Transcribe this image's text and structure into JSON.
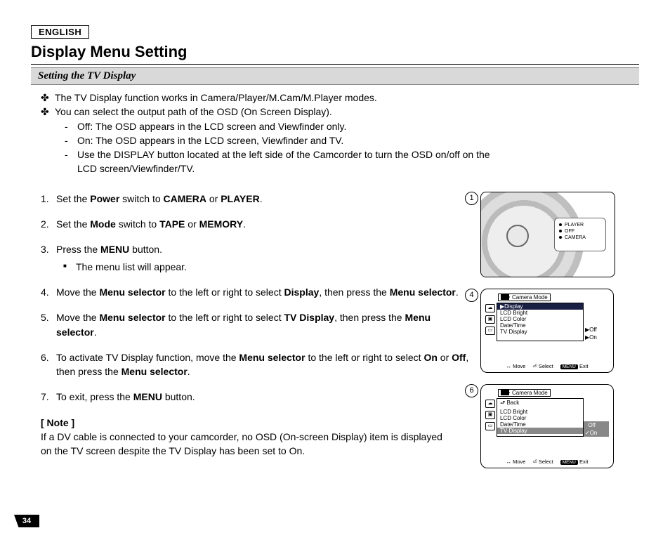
{
  "header": {
    "language": "ENGLISH",
    "title": "Display Menu Setting",
    "subhead": "Setting the TV Display"
  },
  "intro": {
    "line1": "The TV Display function works in Camera/Player/M.Cam/M.Player modes.",
    "line2": "You can select the output path of the OSD (On Screen Display).",
    "sub1": "Off: The OSD appears in the LCD screen and Viewfinder only.",
    "sub2": "On: The OSD appears in the LCD screen, Viewfinder and TV.",
    "sub3a": "Use the DISPLAY button located at the left side of the Camcorder to turn the OSD on/off on the",
    "sub3b": "LCD screen/Viewfinder/TV."
  },
  "steps": {
    "s1a": "Set the ",
    "s1b": "Power",
    "s1c": " switch to ",
    "s1d": "CAMERA",
    "s1e": " or ",
    "s1f": "PLAYER",
    "s1g": ".",
    "s2a": "Set the ",
    "s2b": "Mode",
    "s2c": " switch to ",
    "s2d": "TAPE",
    "s2e": " or ",
    "s2f": "MEMORY",
    "s2g": ".",
    "s3a": "Press the ",
    "s3b": "MENU",
    "s3c": " button.",
    "s3sub": "The menu list will appear.",
    "s4a": "Move the ",
    "s4b": "Menu selector",
    "s4c": " to the left or right to select ",
    "s4d": "Display",
    "s4e": ", then press the ",
    "s4f": "Menu selector",
    "s4g": ".",
    "s5a": "Move the ",
    "s5b": "Menu selector",
    "s5c": " to the left or right to select ",
    "s5d": "TV Display",
    "s5e": ", then press the ",
    "s5f": "Menu selector",
    "s5g": ".",
    "s6a": "To activate TV Display function, move the ",
    "s6b": "Menu selector",
    "s6c": " to the left or right to select ",
    "s6d": "On",
    "s6e": " or ",
    "s6f": "Off",
    "s6g": ",",
    "s6h": "then press the ",
    "s6i": "Menu selector",
    "s6j": ".",
    "s7a": "To exit, press the ",
    "s7b": "MENU",
    "s7c": " button."
  },
  "note": {
    "label": "[ Note ]",
    "body1": "If a DV cable is connected to your camcorder, no OSD (On-screen Display) item is displayed",
    "body2": "on the TV screen despite the TV Display has been set to On."
  },
  "figures": {
    "f1_num": "1",
    "f4_num": "4",
    "f6_num": "6",
    "dial": {
      "player": "PLAYER",
      "off": "OFF",
      "camera": "CAMERA"
    },
    "osd4": {
      "mode": "Camera Mode",
      "items": [
        "Display",
        "LCD Bright",
        "LCD Color",
        "Date/Time",
        "TV Display"
      ],
      "vals": [
        "Off",
        "On"
      ]
    },
    "osd6": {
      "mode": "Camera Mode",
      "back": "Back",
      "items": [
        "LCD Bright",
        "LCD Color",
        "Date/Time",
        "TV Display"
      ],
      "vals": [
        "Off",
        "On"
      ]
    },
    "foot": {
      "move": "Move",
      "select": "Select",
      "menu": "MENU",
      "exit": "Exit"
    }
  },
  "page_number": "34"
}
